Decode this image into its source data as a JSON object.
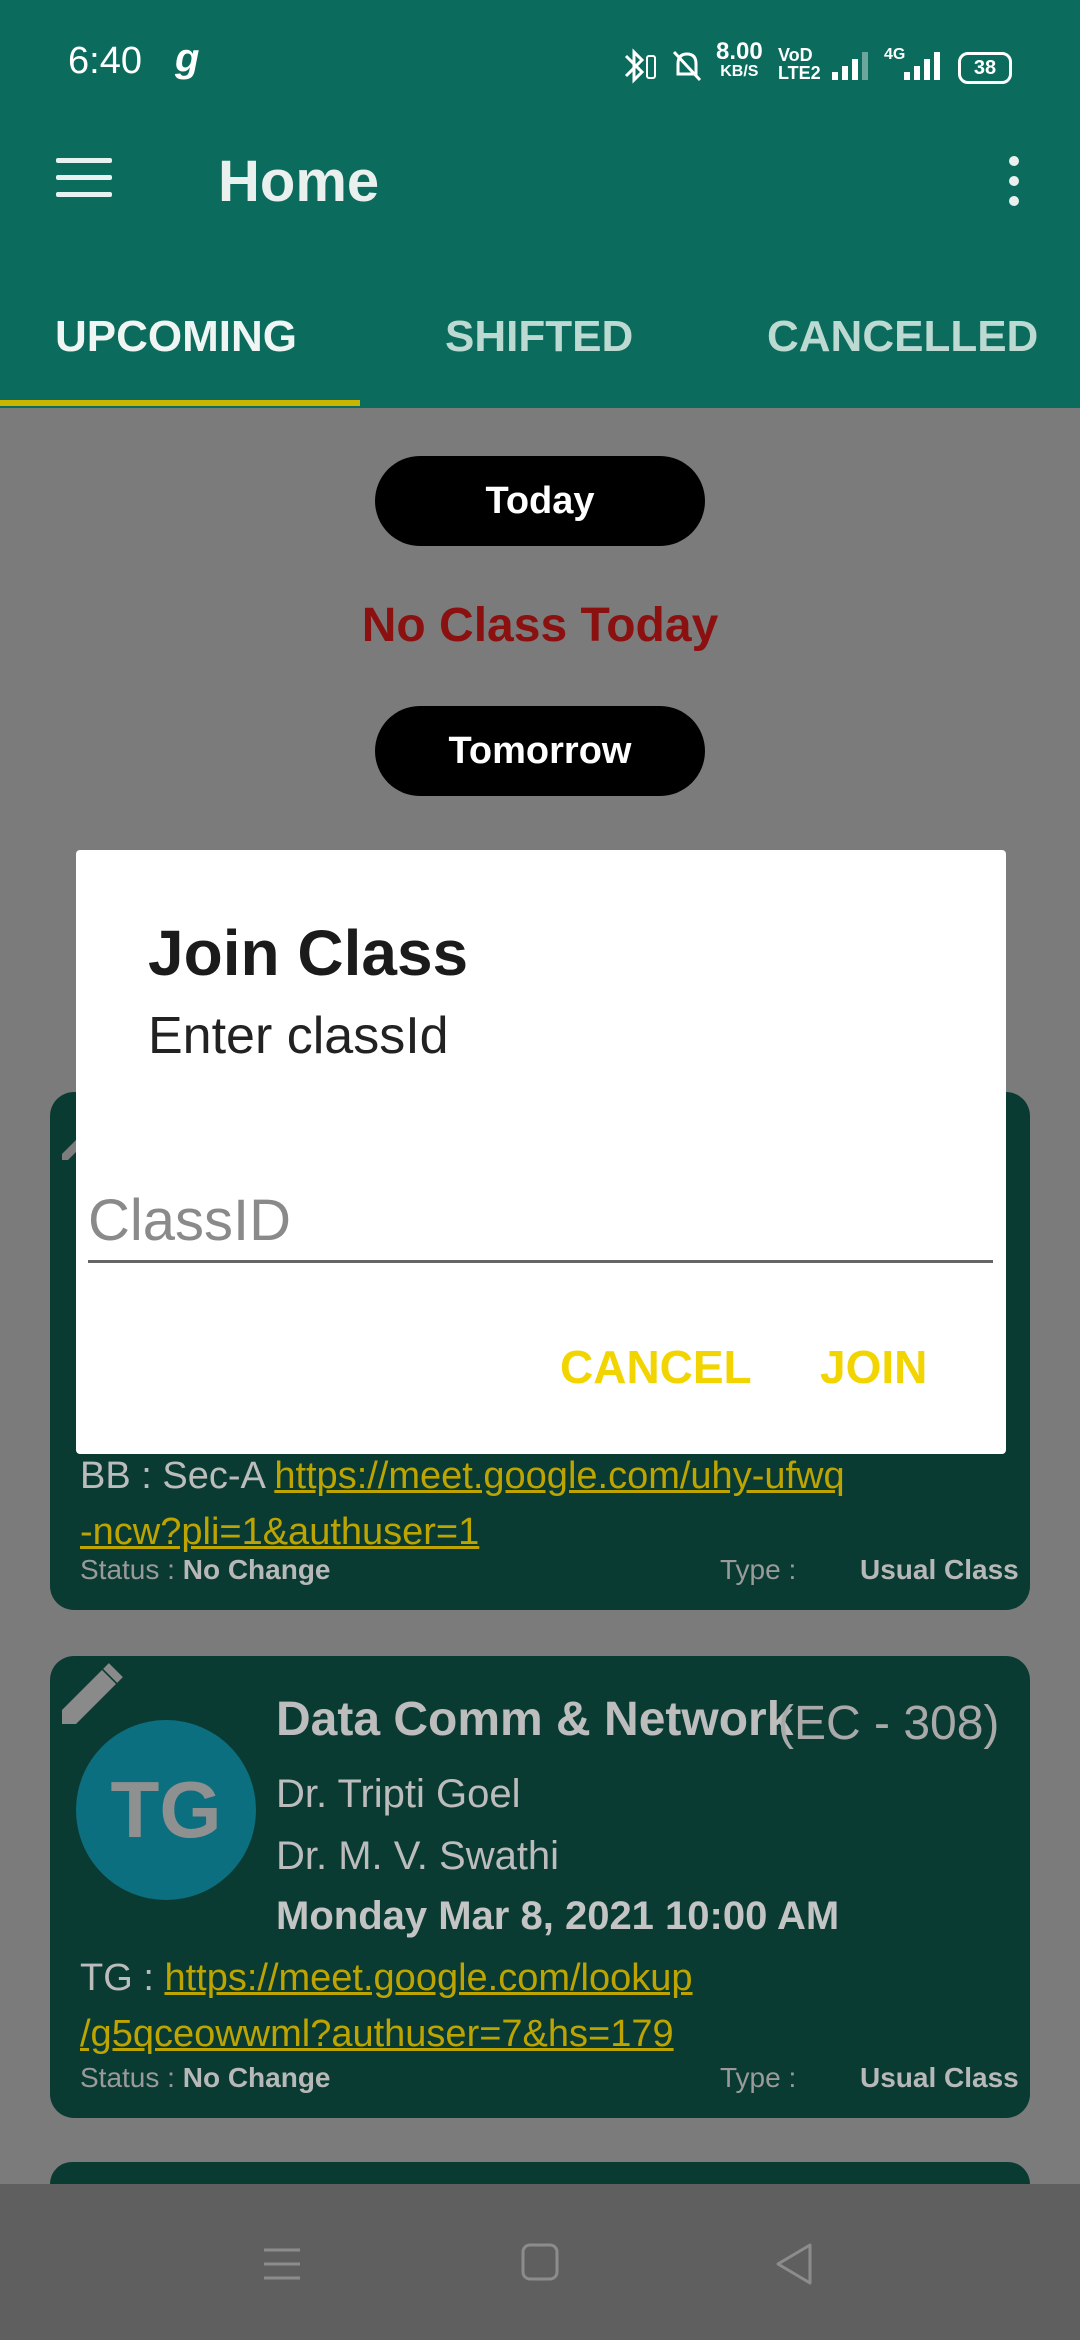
{
  "status_bar": {
    "time": "6:40",
    "app_glyph": "g",
    "net_speed": "8.00",
    "net_unit": "KB/S",
    "volte": "VoD LTE2",
    "net_type": "4G",
    "battery": "38"
  },
  "app_bar": {
    "title": "Home"
  },
  "tabs": [
    {
      "label": "UPCOMING"
    },
    {
      "label": "SHIFTED"
    },
    {
      "label": "CANCELLED"
    }
  ],
  "today": {
    "label": "Today",
    "message": "No Class Today"
  },
  "tomorrow": {
    "label": "Tomorrow"
  },
  "cards": [
    {
      "link_prefix": "BB : Sec-A ",
      "link_line1": "https://meet.google.com/uhy-ufwq",
      "link_line2": "-ncw?pli=1&authuser=1",
      "status_label": "Status : ",
      "status_value": "No Change",
      "type_label": "Type :",
      "type_value": "Usual Class"
    },
    {
      "avatar": "TG",
      "title": "Data Comm & Network",
      "code": "(EC - 308)",
      "faculty1": "Dr. Tripti Goel",
      "faculty2": "Dr. M. V. Swathi",
      "datetime": "Monday Mar 8, 2021 10:00 AM",
      "link_prefix": "TG : ",
      "link_line1": "https://meet.google.com/lookup",
      "link_line2": "/g5qceowwml?authuser=7&hs=179",
      "status_label": "Status : ",
      "status_value": "No Change",
      "type_label": "Type :",
      "type_value": "Usual Class"
    }
  ],
  "dialog": {
    "title": "Join Class",
    "message": "Enter classId",
    "input_placeholder": "ClassID",
    "cancel_label": "CANCEL",
    "join_label": "JOIN"
  },
  "colors": {
    "app_bar": "#0b6b5c",
    "tab_indicator": "#c9b400",
    "accent": "#f2d400",
    "no_class_red": "#8b1010"
  }
}
